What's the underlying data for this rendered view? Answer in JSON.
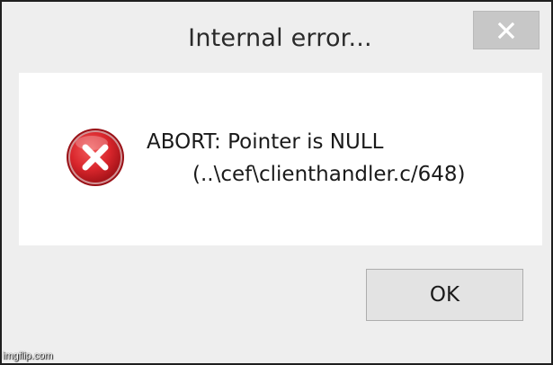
{
  "dialog": {
    "title": "Internal error...",
    "message_line1": "ABORT: Pointer is NULL",
    "message_line2": "(..\\cef\\clienthandler.c/648)",
    "ok_label": "OK"
  },
  "icons": {
    "close": "close-icon",
    "error": "error-icon"
  },
  "colors": {
    "error_red": "#d9262c",
    "close_button_bg": "#c7c7c7",
    "body_bg": "#ffffff",
    "frame_bg": "#eeeeee"
  },
  "watermark": "imgflip.com"
}
